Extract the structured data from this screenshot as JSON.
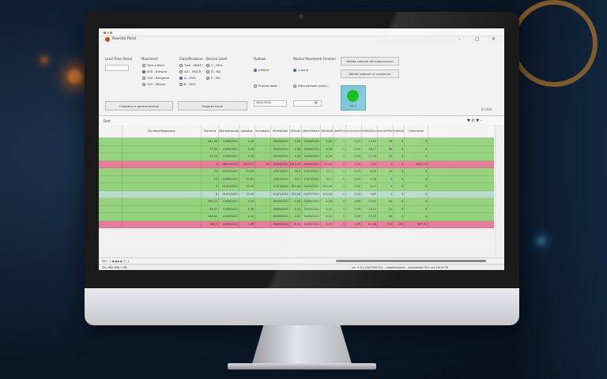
{
  "window": {
    "title": "Reorder Point"
  },
  "toolbar": {
    "lead_time_label": "Lead Time (fisso)",
    "movimenti_label": "Movimenti",
    "movimenti_options": [
      "Tutti e filiali",
      "000 - Brescia",
      "102 - Bergamo",
      "103 - Milano"
    ],
    "classificazione_label": "Classificazione - Service Level",
    "classi_left": [
      "Tutti - MULTI",
      "A/C - MULTI",
      "A - 95%",
      "B - 90%"
    ],
    "classi_right": [
      "C - 85%",
      "D - NA",
      "E - NA"
    ],
    "outlook_label": "Outlook",
    "outlook_options": [
      "Infinito",
      "Precisa data..."
    ],
    "outlook_date": "30/11/2021",
    "storico_label": "Storico Movimenti Fornitori",
    "storico_options": [
      "1 anno",
      "Altro periodo (anni)..."
    ],
    "aggiorna_label": "Aggiorna",
    "agg_colonne_button": "Abilita colonne all'elaborazione",
    "agg_colonne_button2": "Abilita colonne al contenuto",
    "classifica_button": "Classifica e genera articoli",
    "esporta_button": "Esporta Excel",
    "status_tile_text": "OK / 1",
    "counter": "0 / 0.0"
  },
  "grid": {
    "top_left": "Dett.",
    "columns": [
      "",
      "Fornitore/Magazzino",
      "Giacenza",
      "UltimoAcquisto",
      "LottoAcq.",
      "ScortaAcq.",
      "UltimaData",
      "UltimoV.",
      "UltimoDataV.",
      "UltimoVD",
      "LeadTime",
      "ServiceLevel",
      "SafetyStock",
      "ReorderPoint",
      "OrderQty",
      "OrderValue"
    ],
    "rows": [
      {
        "style": "green",
        "cells": [
          "",
          "",
          "341,36",
          "13/09/2021",
          "1,00",
          "",
          "30/09/2021",
          "2,69",
          "30/09/2021",
          "2,69",
          "1",
          "0,99",
          "23,67",
          "98",
          "0",
          "0"
        ]
      },
      {
        "style": "green",
        "cells": [
          "",
          "",
          "77,90",
          "13/09/2021",
          "2,34",
          "",
          "30/09/2021",
          "4,38",
          "30/09/2021",
          "4,38",
          "1",
          "0,99",
          "36,77",
          "86",
          "0",
          "0"
        ]
      },
      {
        "style": "green",
        "cells": [
          "",
          "",
          "47,36",
          "13/09/2021",
          "2,34",
          "",
          "30/09/2021",
          "4,38",
          "30/09/2021",
          "4,38",
          "1",
          "0,99",
          "17,08",
          "32",
          "0",
          "0"
        ]
      },
      {
        "style": "pink",
        "cells": [
          "",
          "",
          "0",
          "06/01/2021",
          "1043,77",
          "53",
          "30/09/2021",
          "1043,70",
          "30/09/2021",
          "11,45",
          "1",
          "0,99",
          "0,43",
          "3",
          "0",
          "1405,70"
        ]
      },
      {
        "style": "green",
        "cells": [
          "",
          "",
          "23",
          "20/05/2021",
          "97,80",
          "",
          "20/07/2021",
          "39,7",
          "20/07/2021",
          "39,7",
          "1",
          "0,99",
          "6,03",
          "13",
          "0",
          "0"
        ]
      },
      {
        "style": "green",
        "cells": [
          "",
          "",
          "15",
          "20/05/2021",
          "97,85",
          "",
          "20/07/2021",
          "39,7",
          "20/07/2021",
          "39,7",
          "1",
          "0,99",
          "1,16",
          "3",
          "0",
          "0"
        ]
      },
      {
        "style": "green",
        "cells": [
          "",
          "",
          "9",
          "01/07/2021",
          "79,33",
          "",
          "01/07/2021",
          "130,46",
          "01/07/2021",
          "130,46",
          "1",
          "0,99",
          "1,17",
          "4",
          "0",
          "0"
        ]
      },
      {
        "style": "lblue",
        "cells": [
          "",
          "",
          "8",
          "01/07/2021",
          "79,33",
          "",
          "01/07/2021",
          "130,46",
          "01/07/2021",
          "130,46",
          "1",
          "0,99",
          "0,67",
          "3",
          "0",
          "0"
        ]
      },
      {
        "style": "green",
        "cells": [
          "",
          "",
          "391,23",
          "13/09/2021",
          "2,34",
          "",
          "30/09/2021",
          "4,38",
          "30/09/2021",
          "4,38",
          "1",
          "0,99",
          "23,01",
          "40",
          "0",
          "0"
        ]
      },
      {
        "style": "green",
        "cells": [
          "",
          "",
          "84,37",
          "13/09/2021",
          "2,36",
          "",
          "30/09/2021",
          "4,32",
          "30/09/2021",
          "4,32",
          "1",
          "0,99",
          "15,22",
          "32",
          "0",
          "0"
        ]
      },
      {
        "style": "green",
        "cells": [
          "",
          "",
          "184,62",
          "13/09/2021",
          "2,34",
          "",
          "30/09/2021",
          "4,32",
          "30/09/2021",
          "4,32",
          "1",
          "0,99",
          "23,03",
          "40",
          "0",
          "0"
        ]
      },
      {
        "style": "pink",
        "cells": [
          "",
          "",
          "583,3",
          "13/09/2021",
          "2,36",
          "",
          "30/09/2021",
          "4,32",
          "30/09/2021",
          "4,32",
          "1",
          "0,99",
          "81,08",
          "743",
          "160",
          "697,91"
        ]
      }
    ]
  },
  "footer": {
    "record_nav": "REC: 1 ◀ ◀ ▶ ▶ 1 / 1",
    "status_left": "TN - 962.906 + 58",
    "status_right": "ver. 5.6.1 (DAT-PSE.00) - Classificazione - Completato 31/1 ore 16:18.78"
  },
  "colors": {
    "row_green": "#95d47c",
    "row_pink": "#e77c9a",
    "row_lightblue": "#b9dccb",
    "status_ok": "#18c01e"
  }
}
